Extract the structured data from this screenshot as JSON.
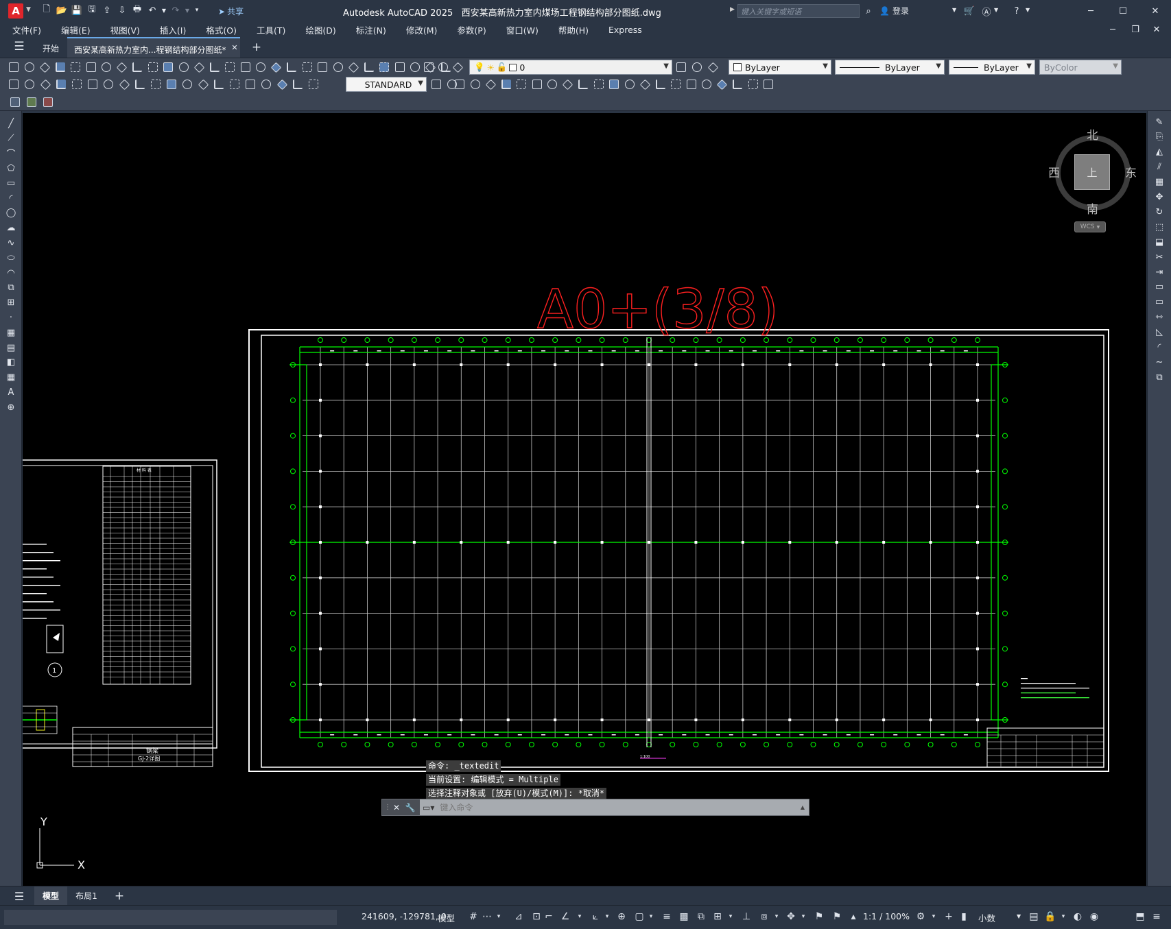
{
  "titlebar": {
    "app_title": "Autodesk AutoCAD 2025",
    "file_name": "西安某高新热力室内煤场工程钢结构部分图纸.dwg",
    "share_label": "共享",
    "search_placeholder": "键入关键字或短语",
    "login_label": "登录",
    "logo_letter": "A"
  },
  "menu": {
    "items": [
      "文件(F)",
      "编辑(E)",
      "视图(V)",
      "插入(I)",
      "格式(O)",
      "工具(T)",
      "绘图(D)",
      "标注(N)",
      "修改(M)",
      "参数(P)",
      "窗口(W)",
      "帮助(H)",
      "Express"
    ]
  },
  "tabs": {
    "start": "开始",
    "document": "西安某高新热力室内...程钢结构部分图纸*"
  },
  "properties": {
    "layer": "0",
    "color": "ByLayer",
    "linetype": "ByLayer",
    "lineweight": "ByLayer",
    "plotstyle": "ByColor",
    "textstyle": "STANDARD"
  },
  "viewcube": {
    "north": "北",
    "south": "南",
    "east": "东",
    "west": "西",
    "top": "上",
    "wcs": "WCS"
  },
  "drawing": {
    "sheet_label": "A0+(3/8)",
    "left_sheet_title1": "钢梁",
    "left_sheet_title2": "GJ-2详图",
    "table_header": "材 料 表"
  },
  "ucs": {
    "x": "X",
    "y": "Y"
  },
  "command": {
    "history": [
      "命令: _textedit",
      "当前设置: 编辑模式 = Multiple",
      "选择注释对象或 [放弃(U)/模式(M)]: *取消*"
    ],
    "placeholder": "键入命令"
  },
  "layout_tabs": {
    "model": "模型",
    "layout1": "布局1"
  },
  "status": {
    "coords": "241609, -129781, 0",
    "mode": "模型",
    "scale": "1:1 / 100%",
    "units": "小数"
  },
  "colors": {
    "bg": "#2b3544",
    "canvas": "#000000",
    "grid": "#00ff00",
    "red": "#ff2020",
    "accent": "#e0252b"
  }
}
